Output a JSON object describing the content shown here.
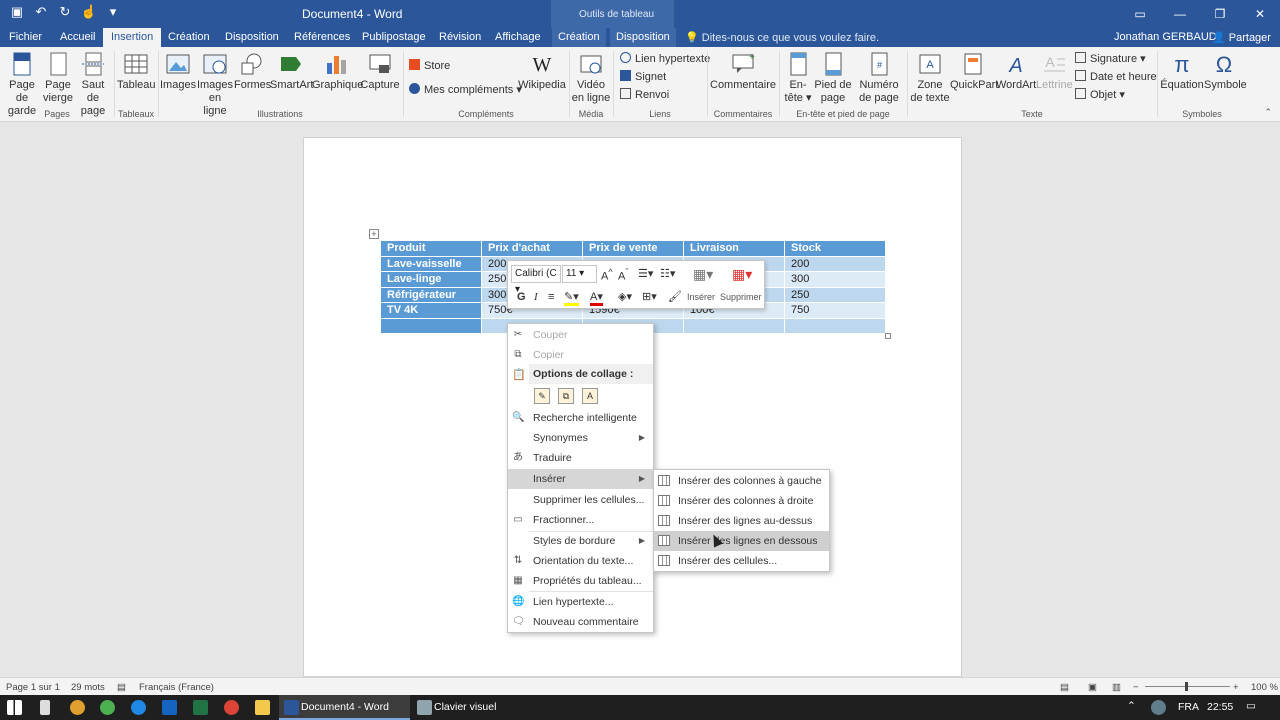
{
  "titlebar": {
    "document_title": "Document4 - Word",
    "context_group": "Outils de tableau",
    "window_controls": [
      "minimize-icon",
      "restore-icon",
      "close-icon"
    ]
  },
  "tabs": {
    "items": [
      "Fichier",
      "Accueil",
      "Insertion",
      "Création",
      "Disposition",
      "Références",
      "Publipostage",
      "Révision",
      "Affichage",
      "Création",
      "Disposition"
    ],
    "active": "Insertion",
    "tell_me": "Dites-nous ce que vous voulez faire.",
    "account": "Jonathan GERBAUD",
    "share": "Partager"
  },
  "ribbon": {
    "page_de_garde": "Page de garde",
    "page_vierge": "Page vierge",
    "saut_de_page": "Saut de page",
    "tableau": "Tableau",
    "images": "Images",
    "images_en_ligne": "Images en ligne",
    "formes": "Formes",
    "smartart": "SmartArt",
    "graphique": "Graphique",
    "capture": "Capture",
    "store": "Store",
    "mes_complements": "Mes compléments",
    "wikipedia": "Wikipedia",
    "video_en_ligne": "Vidéo en ligne",
    "lien_hypertexte": "Lien hypertexte",
    "signet": "Signet",
    "renvoi": "Renvoi",
    "commentaire": "Commentaire",
    "en_tete": "En-tête",
    "pied_de_page": "Pied de page",
    "numero_de_page": "Numéro de page",
    "zone_de_texte": "Zone de texte",
    "quickpart": "QuickPart",
    "wordart": "WordArt",
    "lettrine": "Lettrine",
    "signature": "Signature",
    "date_et_heure": "Date et heure",
    "objet": "Objet",
    "equation": "Équation",
    "symbole": "Symbole",
    "groups": {
      "pages": "Pages",
      "tableaux": "Tableaux",
      "illustrations": "Illustrations",
      "complements": "Compléments",
      "media": "Média",
      "liens": "Liens",
      "commentaires": "Commentaires",
      "entete_pied": "En-tête et pied de page",
      "texte": "Texte",
      "symboles": "Symboles"
    }
  },
  "table": {
    "headers": [
      "Produit",
      "Prix d'achat",
      "Prix de vente",
      "Livraison",
      "Stock"
    ],
    "rows": [
      [
        "Lave-vaisselle",
        "200",
        "",
        "",
        "200"
      ],
      [
        "Lave-linge",
        "250",
        "",
        "",
        "300"
      ],
      [
        "Réfrigérateur",
        "300",
        "",
        "",
        "250"
      ],
      [
        "TV 4K",
        "750€",
        "1590€",
        "100€",
        "750"
      ],
      [
        "",
        "",
        "",
        "",
        ""
      ]
    ]
  },
  "minibar": {
    "font_name": "Calibri (C",
    "font_size": "11",
    "bold": "G",
    "italic": "I",
    "inserer": "Insérer",
    "supprimer": "Supprimer"
  },
  "context_menu": {
    "couper": "Couper",
    "copier": "Copier",
    "options_collage": "Options de collage :",
    "recherche": "Recherche intelligente",
    "synonymes": "Synonymes",
    "traduire": "Traduire",
    "inserer": "Insérer",
    "supprimer_cellules": "Supprimer les cellules...",
    "fractionner": "Fractionner...",
    "styles_bordure": "Styles de bordure",
    "orientation": "Orientation du texte...",
    "proprietes": "Propriétés du tableau...",
    "lien": "Lien hypertexte...",
    "nouveau_commentaire": "Nouveau commentaire"
  },
  "submenu": {
    "items": [
      "Insérer des colonnes à gauche",
      "Insérer des colonnes à droite",
      "Insérer des lignes au-dessus",
      "Insérer des lignes en dessous",
      "Insérer des cellules..."
    ],
    "highlighted_index": 3
  },
  "statusbar": {
    "page": "Page 1 sur 1",
    "words": "29 mots",
    "language": "Français (France)",
    "zoom": "100 %"
  },
  "taskbar": {
    "word_app": "Document4 - Word",
    "keyboard_app": "Clavier visuel",
    "language": "FRA",
    "time": "22:55"
  },
  "colors": {
    "word_blue": "#2b579a",
    "table_header": "#5b9bd5",
    "table_row_light": "#ddebf7",
    "table_row_mid": "#bdd7ee"
  }
}
